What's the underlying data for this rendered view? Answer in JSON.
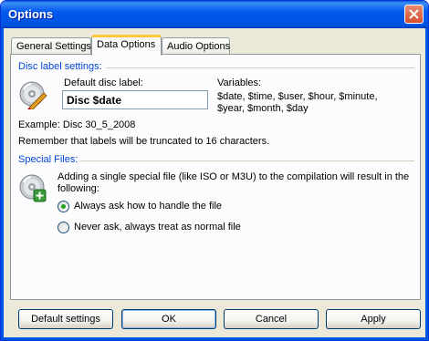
{
  "window": {
    "title": "Options"
  },
  "tabs": [
    {
      "label": "General Settings",
      "active": false
    },
    {
      "label": "Data Options",
      "active": true
    },
    {
      "label": "Audio Options",
      "active": false
    }
  ],
  "disc_label": {
    "section_title": "Disc label settings:",
    "field_label": "Default disc label:",
    "field_value": "Disc $date",
    "variables_title": "Variables:",
    "variables_line1": "$date, $time, $user, $hour, $minute,",
    "variables_line2": "$year, $month, $day",
    "example": "Example: Disc 30_5_2008",
    "note": "Remember that labels will be truncated to 16 characters."
  },
  "special_files": {
    "section_title": "Special Files:",
    "desc_line1": "Adding a single special file (like ISO or M3U)  to the compilation will result in the",
    "desc_line2": "following:",
    "options": [
      {
        "label": "Always ask how to handle the file",
        "selected": true
      },
      {
        "label": "Never ask, always treat as normal file",
        "selected": false
      }
    ]
  },
  "buttons": {
    "default_settings": "Default settings",
    "ok": "OK",
    "cancel": "Cancel",
    "apply": "Apply"
  },
  "icons": {
    "close": "close-icon",
    "disc_edit": "disc-edit-icon",
    "disc_add": "disc-add-icon"
  },
  "colors": {
    "titlebar": "#0054e3",
    "section_label": "#0046d5",
    "active_tab_highlight": "#ffc83c",
    "radio_selected": "#21a121"
  }
}
